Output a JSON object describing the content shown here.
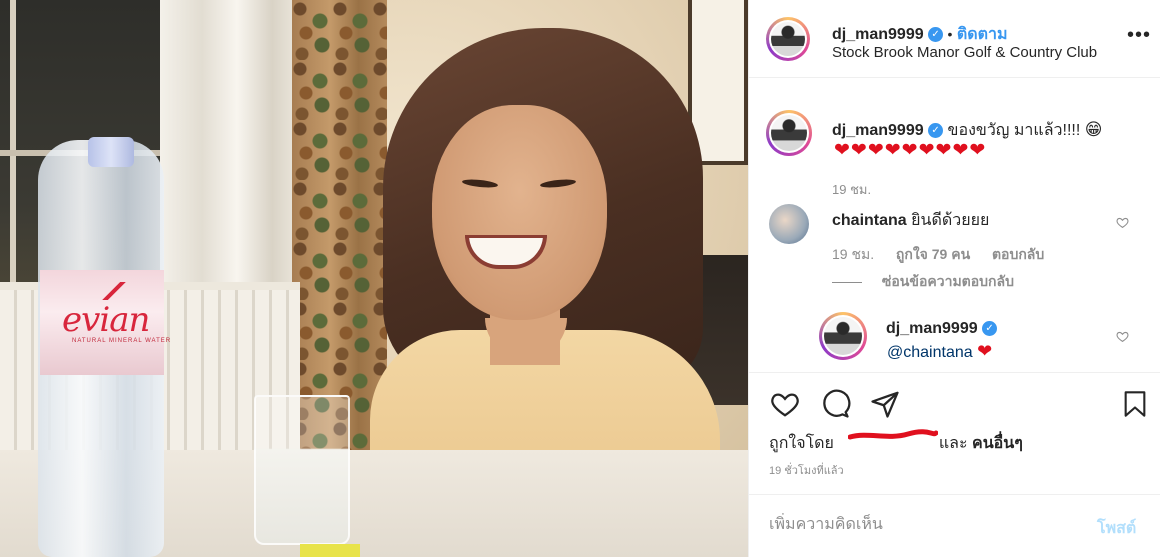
{
  "post_header": {
    "username": "dj_man9999",
    "dot": "•",
    "follow_label": "ติดตาม",
    "location": "Stock Brook Manor Golf & Country Club",
    "more_icon": "more-horizontal-icon"
  },
  "caption": {
    "username": "dj_man9999",
    "text": "ของขวัญ มาแล้ว!!!!",
    "emoji": "😁",
    "hearts": "❤❤❤❤❤❤❤❤❤",
    "time": "19 ชม."
  },
  "comments": [
    {
      "username": "chaintana",
      "text": "ยินดีด้วยยย",
      "time": "19 ชม.",
      "likes": "ถูกใจ 79 คน",
      "reply_label": "ตอบกลับ",
      "hide_replies_label": "ซ่อนข้อความตอบกลับ"
    }
  ],
  "reply": {
    "username": "dj_man9999",
    "mention": "@chaintana",
    "heart": "❤"
  },
  "actions": {
    "like_icon": "heart-outline-icon",
    "comment_icon": "comment-icon",
    "share_icon": "paper-plane-icon",
    "save_icon": "bookmark-icon"
  },
  "likes": {
    "prefix": "ถูกใจโดย",
    "and_label": "และ",
    "others_label": "คนอื่นๆ"
  },
  "timestamp": "19 ชั่วโมงที่แล้ว",
  "add_comment": {
    "placeholder": "เพิ่มความคิดเห็น",
    "post_label": "โพสต์"
  },
  "photo": {
    "bottle_brand": "evian",
    "bottle_sub": "NATURAL MINERAL WATER"
  },
  "colors": {
    "accent": "#3897f0",
    "heart": "#e0101e",
    "text": "#262626",
    "muted": "#8e8e8e"
  }
}
